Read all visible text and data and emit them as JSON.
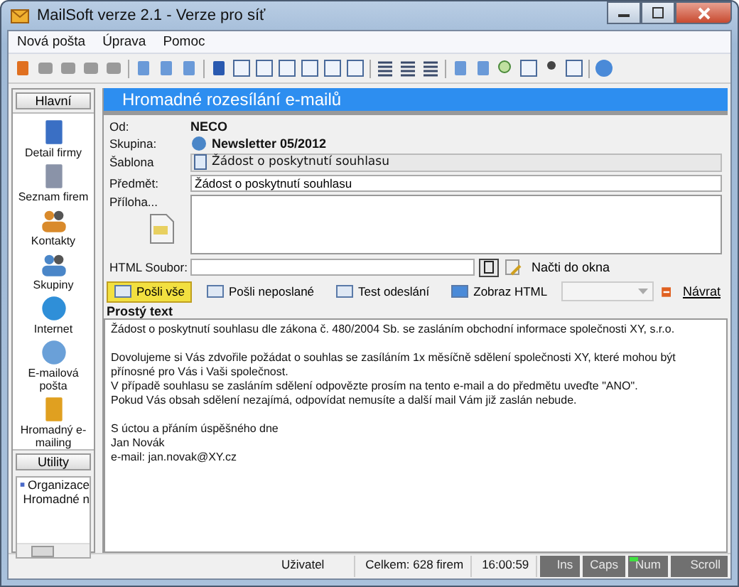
{
  "window": {
    "title": "MailSoft verze 2.1 - Verze pro síť"
  },
  "menu": [
    "Nová pošta",
    "Úprava",
    "Pomoc"
  ],
  "sidebar": {
    "top_button": "Hlavní",
    "items": [
      {
        "label": "Detail firmy"
      },
      {
        "label": "Seznam firem"
      },
      {
        "label": "Kontakty"
      },
      {
        "label": "Skupiny"
      },
      {
        "label": "Internet"
      },
      {
        "label": "E-mailová pošta"
      },
      {
        "label": "Hromadný e-mailing"
      }
    ],
    "bottom_button": "Utility",
    "tree": [
      {
        "label": "Organizace"
      },
      {
        "label": "Hromadné n"
      }
    ]
  },
  "header": "Hromadné rozesílání e-mailů",
  "form": {
    "from_label": "Od:",
    "from": "NECO",
    "group_label": "Skupina:",
    "group": "Newsletter 05/2012",
    "template_label": "Šablona",
    "template": "Žádost o poskytnutí souhlasu",
    "subject_label": "Předmět:",
    "subject": "Žádost o poskytnutí souhlasu",
    "attachment_label": "Příloha...",
    "html_label": "HTML Soubor:",
    "load_button": "Načti do okna"
  },
  "actions": [
    {
      "label": "Pošli vše",
      "selected": true
    },
    {
      "label": "Pošli neposlané",
      "selected": false
    },
    {
      "label": "Test odeslání",
      "selected": false
    },
    {
      "label": "Zobraz HTML",
      "selected": false
    }
  ],
  "back_button": "Návrat",
  "body_title": "Prostý text",
  "body": [
    [
      "Žádost o poskytnutí souhlasu dle zákona č. 480/2004 Sb. se zasláním obchodní informace společnosti XY, s.r.o."
    ],
    [
      "Dovolujeme si Vás zdvořile požádat o souhlas se zasíláním 1x měsíčně sdělení společnosti XY, které mohou být přínosné pro Vás i Vaši společnost.",
      "V případě souhlasu se zasláním sdělení odpovězte prosím na tento e-mail a do předmětu uveďte \"ANO\".",
      "Pokud Vás obsah sdělení nezajímá, odpovídat nemusíte a další mail Vám již zaslán nebude."
    ],
    [
      "S úctou a přáním úspěšného dne",
      "Jan Novák",
      "e-mail: jan.novak@XY.cz"
    ]
  ],
  "status_bar": {
    "user": "Uživatel",
    "total": "Celkem: 628 firem",
    "time": "16:00:59",
    "keys": [
      {
        "label": "Ins",
        "on": false
      },
      {
        "label": "Caps",
        "on": false
      },
      {
        "label": "Num",
        "on": true
      },
      {
        "label": "Scroll",
        "on": false
      }
    ]
  }
}
